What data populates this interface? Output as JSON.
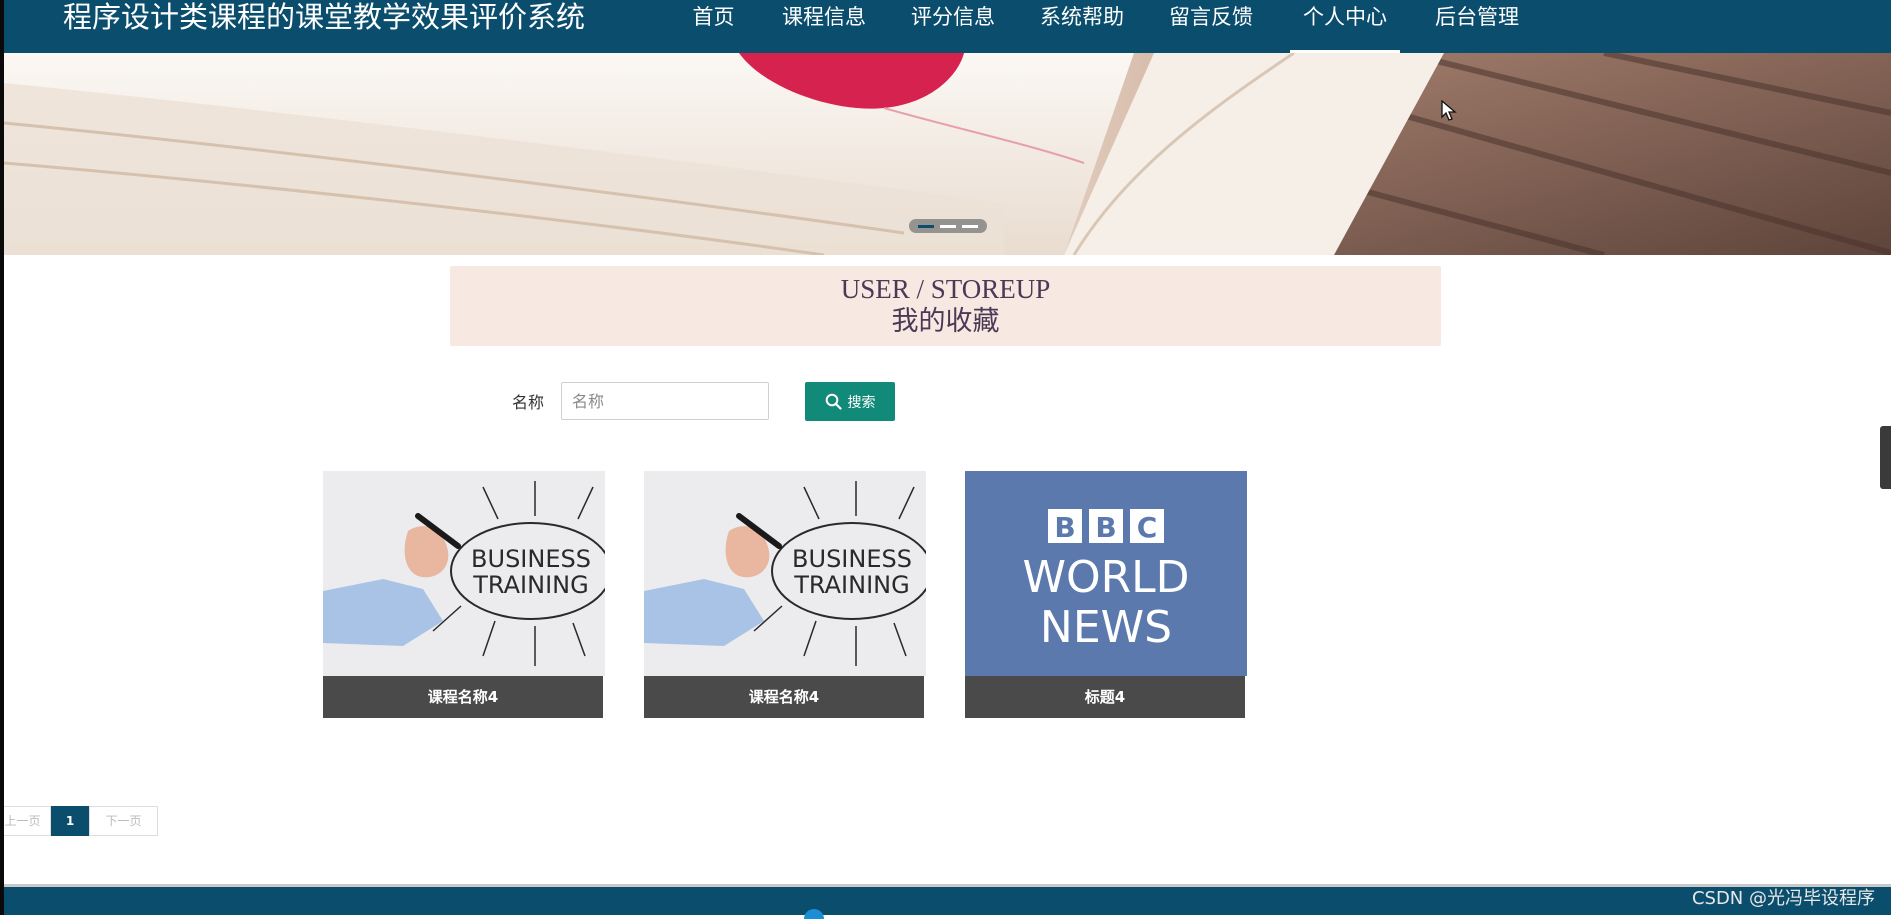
{
  "header": {
    "site_title": "程序设计类课程的课堂教学效果评价系统",
    "nav": [
      {
        "label": "首页"
      },
      {
        "label": "课程信息"
      },
      {
        "label": "评分信息"
      },
      {
        "label": "系统帮助"
      },
      {
        "label": "留言反馈"
      },
      {
        "label": "个人中心",
        "active": true
      },
      {
        "label": "后台管理"
      }
    ]
  },
  "banner": {
    "slides": 3,
    "active_slide": 1
  },
  "section": {
    "title_en": "USER / STOREUP",
    "title_cn": "我的收藏"
  },
  "search": {
    "label": "名称",
    "placeholder": "名称",
    "value": "",
    "button_label": "搜索"
  },
  "cards": [
    {
      "caption": "课程名称4",
      "image": "business-training"
    },
    {
      "caption": "课程名称4",
      "image": "business-training"
    },
    {
      "caption": "标题4",
      "image": "bbc-world-news",
      "image_text": [
        "B",
        "B",
        "C",
        "WORLD",
        "NEWS"
      ]
    }
  ],
  "training_image_text": [
    "BUSINESS",
    "TRAINING"
  ],
  "pagination": {
    "prev_label": "上一页",
    "current_page": "1",
    "next_label": "下一页"
  },
  "watermark": "CSDN @光冯毕设程序",
  "colors": {
    "header_bg": "#0b4d6d",
    "search_button": "#128a7a",
    "section_bg": "#f7e8e2",
    "caption_bg": "#4a4a4a"
  }
}
